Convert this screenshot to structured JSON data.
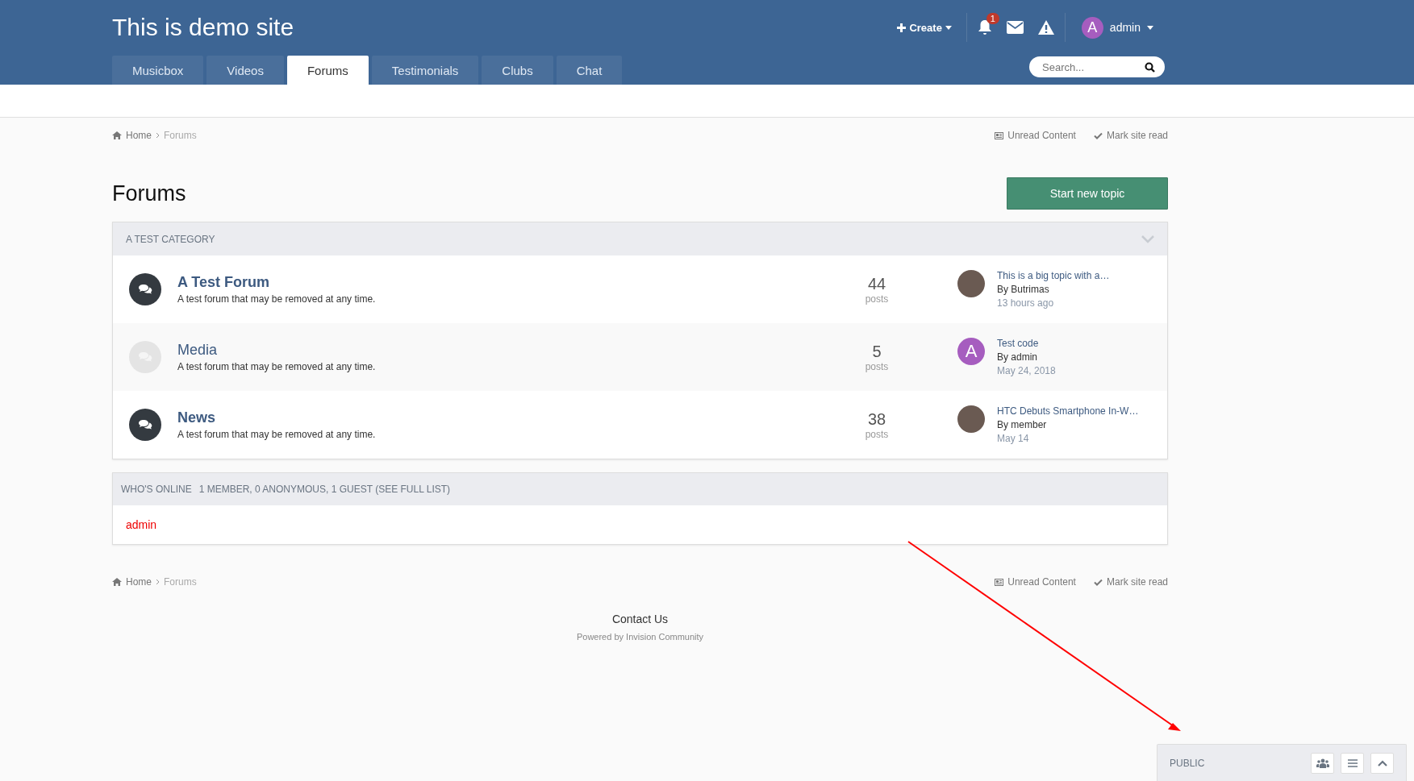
{
  "site_title": "This is demo site",
  "user_bar": {
    "create": "Create",
    "notification_count": "1",
    "avatar_letter": "A",
    "username": "admin"
  },
  "tabs": [
    {
      "label": "Musicbox",
      "selected": false
    },
    {
      "label": "Videos",
      "selected": false
    },
    {
      "label": "Forums",
      "selected": true
    },
    {
      "label": "Testimonials",
      "selected": false
    },
    {
      "label": "Clubs",
      "selected": false
    },
    {
      "label": "Chat",
      "selected": false
    }
  ],
  "search": {
    "placeholder": "Search..."
  },
  "breadcrumb_top": {
    "items": [
      "Home",
      "Forums"
    ],
    "unread": "Unread Content",
    "mark_read": "Mark site read"
  },
  "page_title": "Forums",
  "start_button": "Start new topic",
  "category": {
    "title": "A TEST CATEGORY",
    "expanded": true,
    "forums": [
      {
        "title": "A Test Forum",
        "description": "A test forum that may be removed at any time.",
        "unread": true,
        "count": "44",
        "count_label": "posts",
        "last_topic": "This is a big topic with a…",
        "by": "By Butrimas",
        "time": "13 hours ago",
        "avatar": {
          "kind": "photo"
        }
      },
      {
        "title": "Media",
        "description": "A test forum that may be removed at any time.",
        "unread": false,
        "count": "5",
        "count_label": "posts",
        "last_topic": "Test code",
        "by": "By admin",
        "time": "May 24, 2018",
        "avatar": {
          "kind": "letter",
          "letter": "A"
        }
      },
      {
        "title": "News",
        "description": "A test forum that may be removed at any time.",
        "unread": true,
        "count": "38",
        "count_label": "posts",
        "last_topic": "HTC Debuts Smartphone In-W…",
        "by": "By member",
        "time": "May 14",
        "avatar": {
          "kind": "photo"
        }
      }
    ]
  },
  "whos_online": {
    "title": "WHO'S ONLINE",
    "summary": "1 MEMBER, 0 ANONYMOUS, 1 GUEST (SEE FULL LIST)",
    "users": [
      "admin"
    ]
  },
  "breadcrumb_bottom": {
    "items": [
      "Home",
      "Forums"
    ],
    "unread": "Unread Content",
    "mark_read": "Mark site read"
  },
  "footer": {
    "contact": "Contact Us",
    "powered": "Powered by Invision Community"
  },
  "chat_bar": {
    "label": "PUBLIC"
  }
}
